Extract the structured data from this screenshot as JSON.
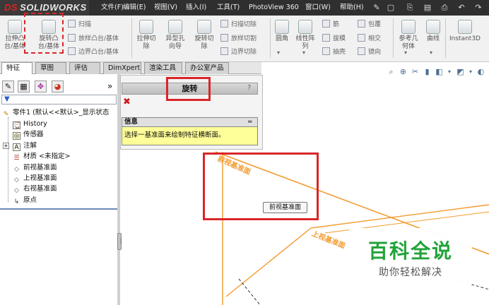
{
  "app": {
    "logo": "SOLIDWORKS",
    "brand_mark": "DS"
  },
  "menu": [
    "文件(F)",
    "编辑(E)",
    "视图(V)",
    "插入(I)",
    "工具(T)",
    "PhotoView 360",
    "窗口(W)",
    "帮助(H)"
  ],
  "ribbon": {
    "extrude_boss": "拉伸凸\n台/基体",
    "revolve_boss": "旋转凸\n台/基体",
    "sweep": "扫描",
    "loft_boss": "放样凸台/基体",
    "boundary_boss": "边界凸台/基体",
    "extrude_cut": "拉伸切\n除",
    "hole_wizard": "异型孔\n向导",
    "revolve_cut": "旋转切\n除",
    "swept_cut": "扫描切除",
    "lofted_cut": "放样切割",
    "boundary_cut": "边界切除",
    "fillet": "圆角",
    "linear_pattern": "线性阵\n列",
    "rib": "筋",
    "draft": "拔模",
    "shell": "抽壳",
    "wrap": "包覆",
    "intersect": "相交",
    "mirror": "镜向",
    "reference_geometry": "参考几\n何体",
    "curves": "曲线",
    "instant3d": "Instant3D"
  },
  "tabs": [
    "特征",
    "草图",
    "评估",
    "DimXpert",
    "渲染工具",
    "办公室产品"
  ],
  "active_tab": "特征",
  "feature_tree": {
    "root": "零件1  (默认<<默认>_显示状态",
    "items": [
      {
        "label": "History",
        "icon": "history-icon"
      },
      {
        "label": "传感器",
        "icon": "sensor-icon"
      },
      {
        "label": "注解",
        "icon": "annotation-icon"
      },
      {
        "label": "材质 <未指定>",
        "icon": "material-icon"
      },
      {
        "label": "前视基准面",
        "icon": "plane-icon"
      },
      {
        "label": "上视基准面",
        "icon": "plane-icon"
      },
      {
        "label": "右视基准面",
        "icon": "plane-icon"
      },
      {
        "label": "原点",
        "icon": "origin-icon"
      }
    ],
    "expand_arrows": "»"
  },
  "property_manager": {
    "title": "旋转",
    "help": "?",
    "close_glyph": "✖",
    "info_header": "信息",
    "info_collapse": "≈",
    "info_text": "选择一基准面来绘制特征横断面。"
  },
  "viewport": {
    "front_plane_label": "前视基准面",
    "top_plane_label": "上视基准面",
    "tooltip": "前视基准面"
  },
  "watermark": {
    "title": "百科全说",
    "subtitle": "助你轻松解决"
  },
  "colors": {
    "plane_orange": "#f39a2e",
    "annotation_red": "#d9262a",
    "info_yellow": "#ffff99",
    "watermark_green": "#22a33a"
  }
}
